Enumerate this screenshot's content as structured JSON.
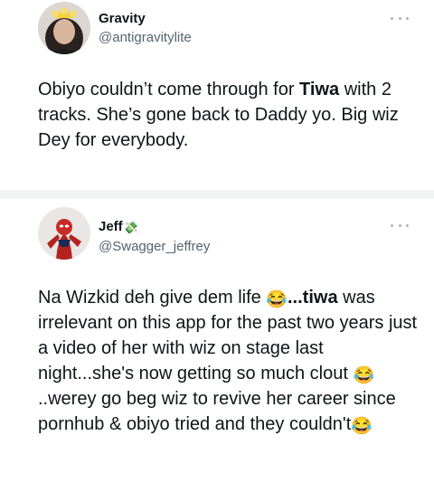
{
  "tweets": [
    {
      "display_name": "Gravity",
      "handle": "@antigravitylite",
      "text_before": "Obiyo couldn’t come through for ",
      "text_bold": "Tiwa",
      "text_after": " with 2 tracks. She’s gone back to Daddy yo. Big wiz Dey for everybody."
    },
    {
      "display_name": "Jeff",
      "name_emoji": "💸",
      "handle": "@Swagger_jeffrey",
      "text_1": "Na Wizkid deh give dem life ",
      "emoji": "😂",
      "text_2": "...tiwa",
      "text_3": " was irrelevant on this app for the past two years just a video of her with wiz on stage last night...she's now getting so much clout ",
      "text_4": "..werey go beg wiz to revive her career since pornhub & obiyo tried and they couldn't"
    }
  ],
  "colors": {
    "text": "#0f1419",
    "secondary": "#536471",
    "divider": "#f2f3f4"
  },
  "icons": {
    "more": "more-dots-icon",
    "avatar_1": "avatar-gravity",
    "avatar_2": "avatar-jeff"
  }
}
